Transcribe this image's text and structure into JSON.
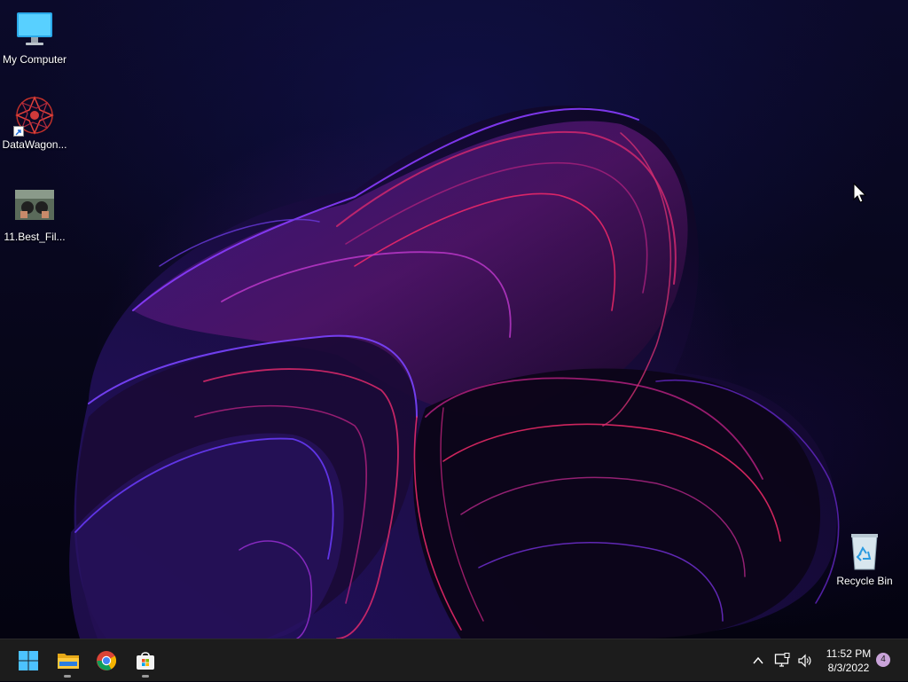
{
  "desktop": {
    "icons": [
      {
        "label": "My Computer",
        "icon": "computer-icon"
      },
      {
        "label": "DataWagon...",
        "icon": "datawagon-icon"
      },
      {
        "label": "11.Best_Fil...",
        "icon": "image-thumbnail-icon"
      },
      {
        "label": "Recycle Bin",
        "icon": "recycle-bin-icon"
      }
    ]
  },
  "taskbar": {
    "apps": [
      {
        "name": "Start",
        "icon": "windows-logo-icon"
      },
      {
        "name": "File Explorer",
        "icon": "folder-icon"
      },
      {
        "name": "Google Chrome",
        "icon": "chrome-icon"
      },
      {
        "name": "Microsoft Store",
        "icon": "store-icon"
      }
    ],
    "tray": {
      "show_hidden_icon": "chevron-up-icon",
      "network_icon": "network-icon",
      "volume_icon": "speaker-icon",
      "time": "11:52 PM",
      "date": "8/3/2022",
      "notification_count": "4"
    }
  },
  "colors": {
    "taskbar_bg": "#1c1c1c",
    "accent_blue": "#4cc2ff",
    "wallpaper_magenta": "#c0207a",
    "wallpaper_violet": "#6a2ad0"
  }
}
